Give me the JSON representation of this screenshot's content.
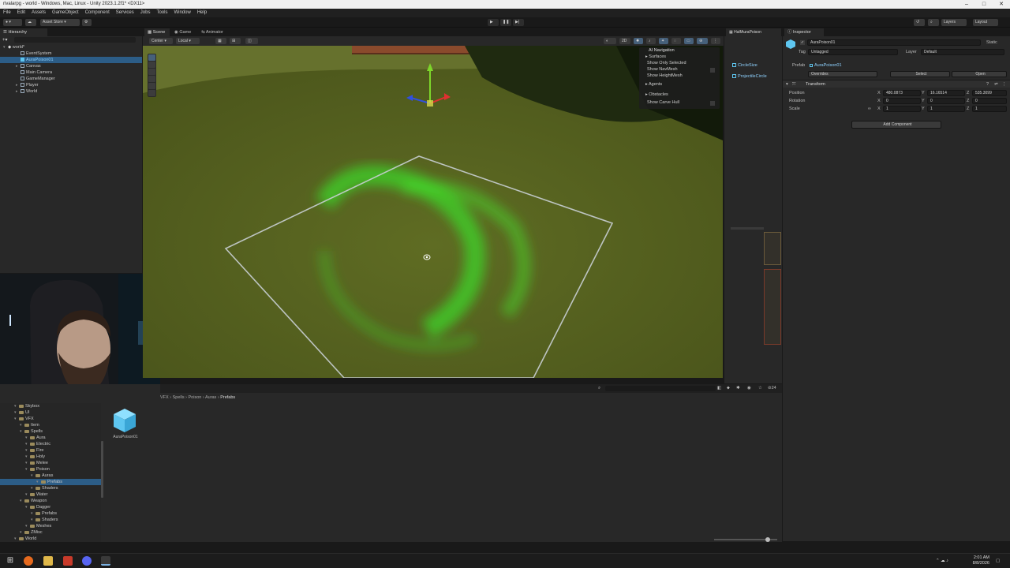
{
  "window": {
    "title": "rivalarpg - world - Windows, Mac, Linux - Unity 2023.1.2f1* <DX11>",
    "controls": [
      "–",
      "□",
      "✕"
    ]
  },
  "menu": [
    "File",
    "Edit",
    "Assets",
    "GameObject",
    "Component",
    "Services",
    "Jobs",
    "Tools",
    "Window",
    "Help"
  ],
  "toolbar": {
    "asset_store": "Asset Store ▾",
    "layers": "Layers",
    "layout": "Layout"
  },
  "hierarchy": {
    "tab": "Hierarchy",
    "scene": "world*",
    "items": [
      "EventSystem",
      "AuraPoison01",
      "Canvas",
      "Main Camera",
      "GameManager",
      "Player",
      "World"
    ]
  },
  "scene_view": {
    "tabs": [
      "Scene",
      "Game",
      "Animator"
    ],
    "pivot": "Center",
    "space": "Local",
    "mode_2d": "2D",
    "overlay": {
      "title": "AI Navigation",
      "items": [
        "Surfaces",
        "Show Only Selected",
        "Show NavMesh",
        "Show HeightMesh",
        "Agents",
        "Obstacles",
        "Show Carve Hull"
      ]
    }
  },
  "prefab_hierarchy": {
    "tab": "HalfAuraPoison",
    "items": [
      "CircleSize",
      "ProjectileCircle"
    ]
  },
  "inspector": {
    "tab": "Inspector",
    "object_name": "AuraPoison01",
    "static_label": "Static",
    "tag_label": "Tag",
    "tag_value": "Untagged",
    "layer_label": "Layer",
    "layer_value": "Default",
    "prefab_label": "Prefab",
    "prefab_value": "AuraPoison01",
    "overrides": "Overrides",
    "select": "Select",
    "open": "Open",
    "component": "Transform",
    "position_label": "Position",
    "rotation_label": "Rotation",
    "scale_label": "Scale",
    "position": {
      "x": "480.0873",
      "y": "16.16514",
      "z": "535.3099"
    },
    "rotation": {
      "x": "0",
      "y": "0",
      "z": "0"
    },
    "scale": {
      "x": "1",
      "y": "1",
      "z": "1"
    },
    "add_component": "Add Component"
  },
  "project": {
    "breadcrumb": [
      "VFX",
      "Spells",
      "Poison",
      "Auras",
      "Prefabs"
    ],
    "badge": "24",
    "folders": [
      {
        "name": "Skybox",
        "depth": 0
      },
      {
        "name": "UI",
        "depth": 0
      },
      {
        "name": "VFX",
        "depth": 0
      },
      {
        "name": "Item",
        "depth": 1
      },
      {
        "name": "Spells",
        "depth": 1
      },
      {
        "name": "Aura",
        "depth": 2
      },
      {
        "name": "Electric",
        "depth": 2
      },
      {
        "name": "Fire",
        "depth": 2
      },
      {
        "name": "Holy",
        "depth": 2
      },
      {
        "name": "Melee",
        "depth": 2
      },
      {
        "name": "Poison",
        "depth": 2
      },
      {
        "name": "Auras",
        "depth": 3
      },
      {
        "name": "Prefabs",
        "depth": 4
      },
      {
        "name": "Shaders",
        "depth": 3
      },
      {
        "name": "Water",
        "depth": 2
      },
      {
        "name": "Weapon",
        "depth": 1
      },
      {
        "name": "Dagger",
        "depth": 2
      },
      {
        "name": "Prefabs",
        "depth": 3
      },
      {
        "name": "Shaders",
        "depth": 3
      },
      {
        "name": "Meshes",
        "depth": 2
      },
      {
        "name": "ZMisc",
        "depth": 1
      },
      {
        "name": "World",
        "depth": 0
      }
    ],
    "asset_name": "AuraPoison01"
  },
  "clock": {
    "time": "2:01 AM",
    "date": "8/8/2026"
  },
  "colors": {
    "accent": "#2c5d87",
    "grass": "#55611f",
    "poison": "#3fd42a",
    "prefab_blue": "#5ec6f0"
  }
}
